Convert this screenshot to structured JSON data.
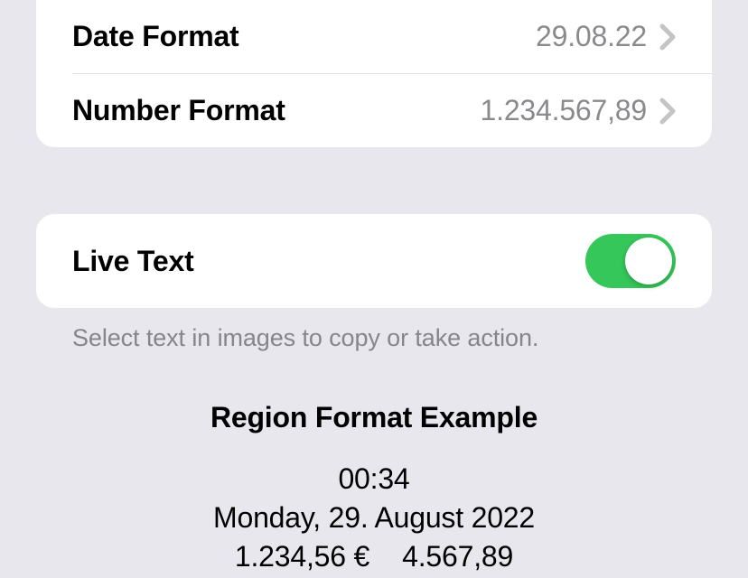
{
  "rows": {
    "dateFormat": {
      "label": "Date Format",
      "value": "29.08.22"
    },
    "numberFormat": {
      "label": "Number Format",
      "value": "1.234.567,89"
    }
  },
  "liveText": {
    "label": "Live Text",
    "caption": "Select text in images to copy or take action.",
    "enabled": true
  },
  "example": {
    "title": "Region Format Example",
    "time": "00:34",
    "date": "Monday, 29. August 2022",
    "currency": "1.234,56 €",
    "number": "4.567,89"
  }
}
